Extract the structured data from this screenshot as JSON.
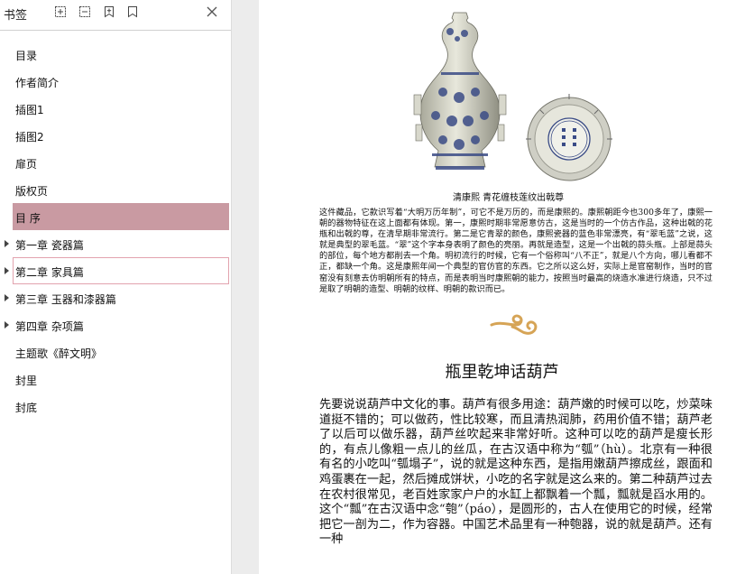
{
  "sidebar": {
    "title": "书签",
    "toolbar": [
      "expand-all-icon",
      "collapse-all-icon",
      "add-bookmark-icon",
      "bookmark-icon"
    ],
    "items": [
      {
        "label": "目录",
        "has_children": false
      },
      {
        "label": "作者简介",
        "has_children": false
      },
      {
        "label": "插图1",
        "has_children": false
      },
      {
        "label": "插图2",
        "has_children": false
      },
      {
        "label": "扉页",
        "has_children": false
      },
      {
        "label": "版权页",
        "has_children": false
      },
      {
        "label": "目  序",
        "has_children": false,
        "selected": true
      },
      {
        "label": "第一章   瓷器篇",
        "has_children": true
      },
      {
        "label": "第二章   家具篇",
        "has_children": true,
        "hovered": true
      },
      {
        "label": "第三章   玉器和漆器篇",
        "has_children": true
      },
      {
        "label": "第四章   杂项篇",
        "has_children": true
      },
      {
        "label": "主题歌《醉文明》",
        "has_children": false
      },
      {
        "label": "封里",
        "has_children": false
      },
      {
        "label": "封底",
        "has_children": false
      }
    ],
    "selected_color": "#c99aa2"
  },
  "page": {
    "caption": "清康熙   青花缠枝莲纹出戟尊",
    "small_text": "这件藏品，它款识写着“大明万历年制”，可它不是万历的，而是康熙的。康熙朝距今也300多年了，康熙一朝的器物特征在这上面都有体现。第一，康熙时期非常愿意仿古，这是当时的一个仿古作品，这种出戟的花瓶和出戟的尊，在清早期非常流行。第二是它青翠的颜色，康熙瓷器的蓝色非常漂亮，有“翠毛蓝”之说，这就是典型的翠毛蓝。“翠”这个字本身表明了颜色的亮丽。再就是造型，这是一个出戟的蒜头瓶。上部是蒜头的部位，每个地方都削去一个角。明初流行的时候，它有一个俗称叫“八不正”，就是八个方向，哪儿看都不正，都缺一个角。这是康熙年间一个典型的官仿官的东西。它之所以这么好，实际上是官窑制作，当时的官窑没有刻意去仿明朝所有的特点，而是表明当时康熙朝的能力，按照当时最高的烧造水准进行烧造，只不过是取了明朝的造型、明朝的纹样、明朝的款识而已。",
    "heading": "瓶里乾坤话葫芦",
    "body_text": "先要说说葫芦中文化的事。葫芦有很多用途：葫芦嫩的时候可以吃，炒菜味道挺不错的；可以做药，性比较寒，而且清热润肺，药用价值不错；葫芦老了以后可以做乐器，葫芦丝吹起来非常好听。这种可以吃的葫芦是瘦长形的，有点儿像粗一点儿的丝瓜，在古汉语中称为“瓠”（hù）。北京有一种很有名的小吃叫“瓠塌子”，说的就是这种东西，是指用嫩葫芦擦成丝，跟面和鸡蛋裹在一起，然后摊成饼状，小吃的名字就是这么来的。第二种葫芦过去在农村很常见，老百姓家家户户的水缸上都飘着一个瓢，瓢就是舀水用的。这个“瓢”在古汉语中念“匏”（páo），是圆形的，古人在使用它的时候，经常把它一剖为二，作为容器。中国艺术品里有一种匏器，说的就是葫芦。还有一种",
    "images": [
      "vase-photo",
      "vase-mark-photo",
      "cloud-ornament"
    ]
  }
}
